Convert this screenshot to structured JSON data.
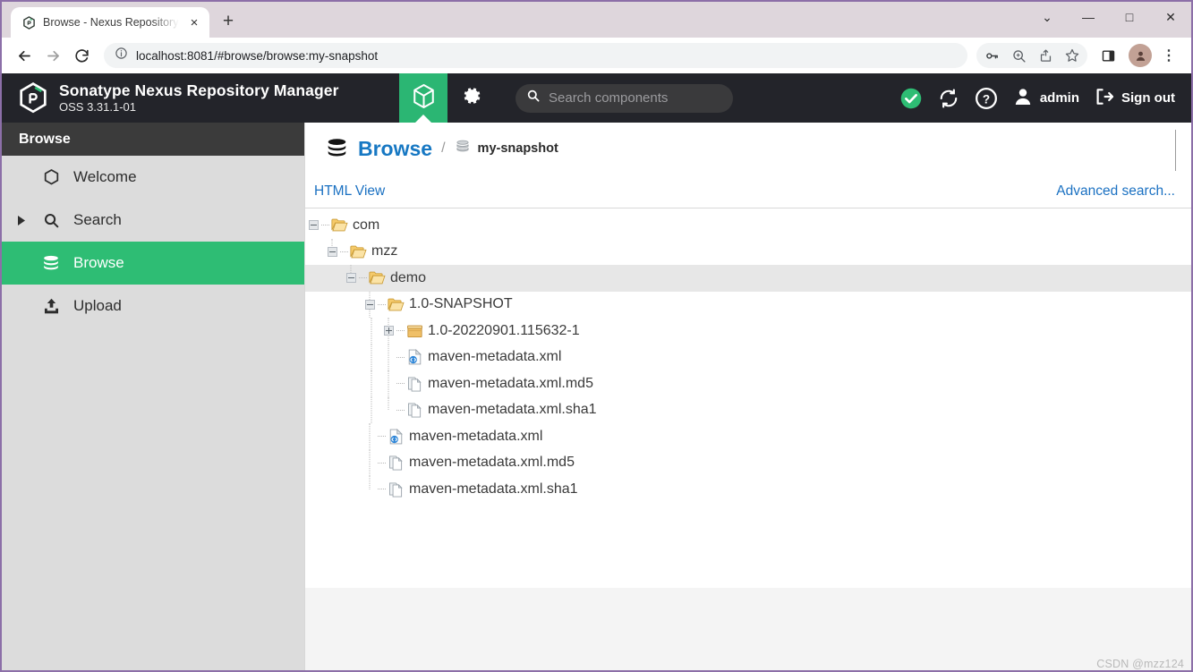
{
  "browser": {
    "tab": {
      "title": "Browse - Nexus Repository Ma",
      "favicon_name": "nexus-favicon",
      "close_label": "×"
    },
    "newtab_label": "+",
    "window_controls": [
      {
        "name": "tab-search-button",
        "glyph": "⌄"
      },
      {
        "name": "minimize-button",
        "glyph": "—"
      },
      {
        "name": "maximize-button",
        "glyph": "□"
      },
      {
        "name": "close-window-button",
        "glyph": "✕"
      }
    ],
    "toolbar": {
      "back_glyph": "←",
      "forward_glyph": "→",
      "reload_glyph": "⟳",
      "url": "localhost:8081/#browse/browse:my-snapshot",
      "site_info_glyph": "ⓘ",
      "right_icons": [
        {
          "name": "password-key-icon",
          "glyph": "⚷"
        },
        {
          "name": "zoom-icon",
          "glyph": "⊕"
        },
        {
          "name": "share-icon",
          "glyph": "↱"
        },
        {
          "name": "bookmark-star-icon",
          "glyph": "☆"
        }
      ],
      "side_panel_glyph": "▣",
      "menu_glyph": "⋮"
    }
  },
  "nexus": {
    "brand": {
      "title": "Sonatype Nexus Repository Manager",
      "version": "OSS 3.31.1-01"
    },
    "header_tabs": [
      {
        "name": "browse-cube-tab",
        "icon": "cube-icon",
        "active": true
      },
      {
        "name": "admin-gear-tab",
        "icon": "gear-icon",
        "active": false
      }
    ],
    "search": {
      "placeholder": "Search components",
      "icon": "search-icon"
    },
    "header_right": {
      "health_icon": "check-circle-icon",
      "refresh_icon": "refresh-icon",
      "help_icon": "help-circle-icon",
      "user_icon": "user-icon",
      "user_label": "admin",
      "signout_icon": "sign-out-icon",
      "signout_label": "Sign out"
    },
    "sidebar": {
      "header": "Browse",
      "items": [
        {
          "label": "Welcome",
          "icon": "hexagon-icon",
          "caret": false,
          "selected": false
        },
        {
          "label": "Search",
          "icon": "search-icon",
          "caret": true,
          "selected": false
        },
        {
          "label": "Browse",
          "icon": "database-icon",
          "caret": false,
          "selected": true
        },
        {
          "label": "Upload",
          "icon": "upload-icon",
          "caret": false,
          "selected": false
        }
      ]
    },
    "breadcrumb": {
      "root_icon": "database-icon",
      "root": "Browse",
      "separator": "/",
      "leaf_icon": "repository-icon",
      "leaf": "my-snapshot"
    },
    "links": {
      "html_view": "HTML View",
      "advanced_search": "Advanced search..."
    },
    "tree": [
      {
        "label": "com",
        "depth": 0,
        "toggle": "minus",
        "icon": "folder-open-icon",
        "selected": false
      },
      {
        "label": "mzz",
        "depth": 1,
        "toggle": "minus",
        "icon": "folder-open-icon",
        "selected": false
      },
      {
        "label": "demo",
        "depth": 2,
        "toggle": "minus",
        "icon": "folder-open-icon",
        "selected": true
      },
      {
        "label": "1.0-SNAPSHOT",
        "depth": 3,
        "toggle": "minus",
        "icon": "folder-open-icon",
        "selected": false
      },
      {
        "label": "1.0-20220901.115632-1",
        "depth": 4,
        "toggle": "plus",
        "icon": "package-icon",
        "selected": false
      },
      {
        "label": "maven-metadata.xml",
        "depth": 4,
        "toggle": "none",
        "icon": "xml-file-icon",
        "selected": false
      },
      {
        "label": "maven-metadata.xml.md5",
        "depth": 4,
        "toggle": "none",
        "icon": "file-copy-icon",
        "selected": false
      },
      {
        "label": "maven-metadata.xml.sha1",
        "depth": 4,
        "toggle": "none",
        "icon": "file-copy-icon",
        "selected": false
      },
      {
        "label": "maven-metadata.xml",
        "depth": 3,
        "toggle": "none",
        "icon": "xml-file-icon",
        "selected": false
      },
      {
        "label": "maven-metadata.xml.md5",
        "depth": 3,
        "toggle": "none",
        "icon": "file-copy-icon",
        "selected": false
      },
      {
        "label": "maven-metadata.xml.sha1",
        "depth": 3,
        "toggle": "none",
        "icon": "file-copy-icon",
        "selected": false
      }
    ],
    "watermark": "CSDN @mzz124",
    "colors": {
      "accent_green": "#2ebd74",
      "header_dark": "#23242a",
      "link_blue": "#1b71c2"
    }
  }
}
